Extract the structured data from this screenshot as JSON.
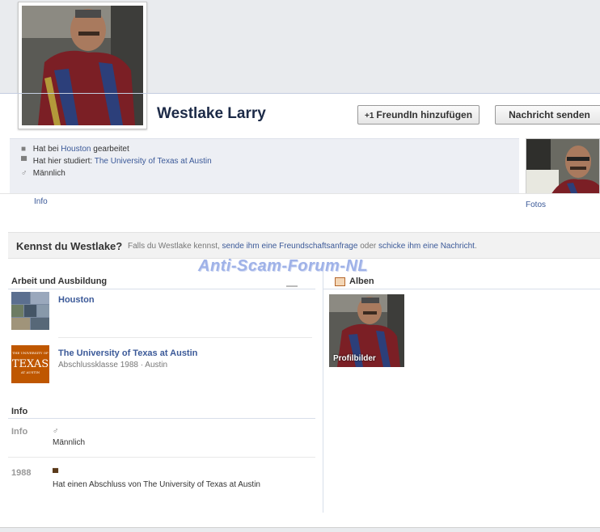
{
  "profile": {
    "name": "Westlake Larry",
    "add_friend_label": "FreundIn hinzufügen",
    "add_friend_prefix": "+1",
    "message_label": "Nachricht senden"
  },
  "info_lines": {
    "work_prefix": "Hat bei",
    "work_place": "Houston",
    "work_suffix": "gearbeitet",
    "study_prefix": "Hat hier studiert:",
    "study_place": "The University of Texas at Austin",
    "gender": "Männlich"
  },
  "tabs": {
    "info": "Info",
    "fotos": "Fotos"
  },
  "know_bar": {
    "title": "Kennst du Westlake?",
    "text_part1": "Falls du Westlake kennst,",
    "link1": "sende ihm eine Freundschaftsanfrage",
    "text_part2": "oder",
    "link2": "schicke ihm eine Nachricht",
    "text_end": "."
  },
  "watermark": "Anti-Scam-Forum-NL",
  "work_education": {
    "title": "Arbeit und Ausbildung",
    "items": [
      {
        "name": "Houston",
        "sub": ""
      },
      {
        "name": "The University of Texas at Austin",
        "sub": "Abschlussklasse 1988 · Austin"
      }
    ],
    "texas_logo_top": "THE UNIVERSITY OF",
    "texas_logo_main": "TEXAS",
    "texas_logo_bottom": "AT AUSTIN"
  },
  "info_section": {
    "title": "Info",
    "rows": [
      {
        "label": "Info",
        "value": "Männlich"
      },
      {
        "label": "1988",
        "value": "Hat einen Abschluss von The University of Texas at Austin"
      }
    ]
  },
  "albums": {
    "title": "Alben",
    "items": [
      {
        "label": "Profilbilder"
      }
    ]
  },
  "colors": {
    "link": "#3b5998",
    "texas_orange": "#bf5700",
    "header_name": "#1c2a47"
  }
}
